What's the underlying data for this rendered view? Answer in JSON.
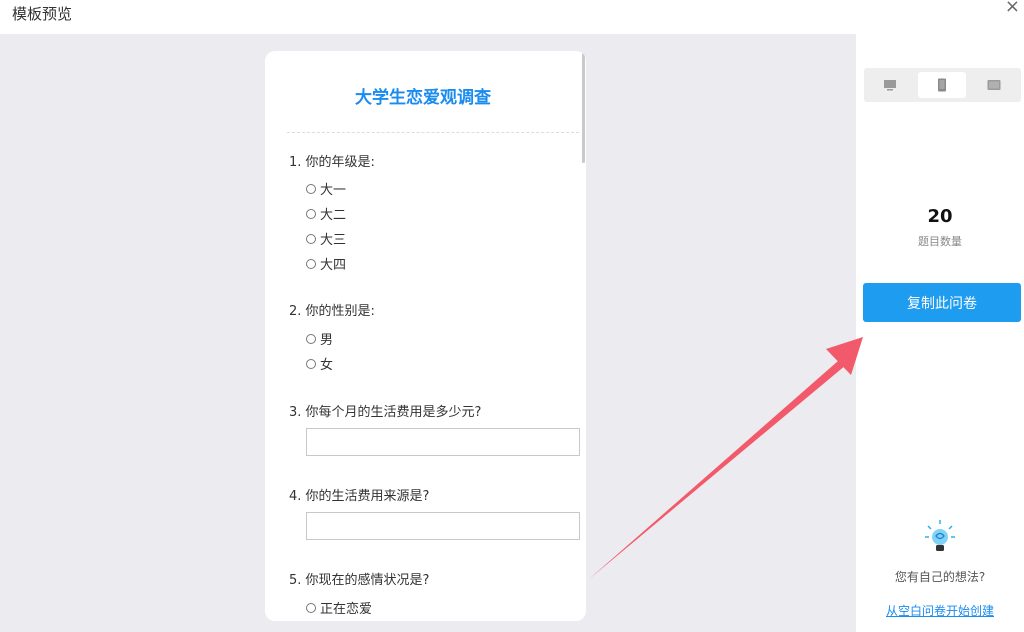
{
  "dialog": {
    "title": "模板预览",
    "close": "×"
  },
  "survey": {
    "title": "大学生恋爱观调查",
    "questions": [
      {
        "label": "1. 你的年级是:",
        "options": [
          "大一",
          "大二",
          "大三",
          "大四"
        ]
      },
      {
        "label": "2. 你的性别是:",
        "options": [
          "男",
          "女"
        ]
      },
      {
        "label": "3. 你每个月的生活费用是多少元?"
      },
      {
        "label": "4. 你的生活费用来源是?"
      },
      {
        "label": "5. 你现在的感情状况是?",
        "options": [
          "正在恋爱"
        ]
      }
    ]
  },
  "sidebar": {
    "view_modes": [
      {
        "icon": "desktop-icon",
        "active": false
      },
      {
        "icon": "mobile-icon",
        "active": true
      },
      {
        "icon": "tablet-icon",
        "active": false
      }
    ],
    "question_count": "20",
    "question_count_label": "题目数量",
    "copy_button": "复制此问卷",
    "idea_text": "您有自己的想法?",
    "create_link": "从空白问卷开始创建"
  },
  "colors": {
    "accent": "#1e9cf0",
    "arrow": "#f25a6b",
    "background": "#ececf0"
  }
}
